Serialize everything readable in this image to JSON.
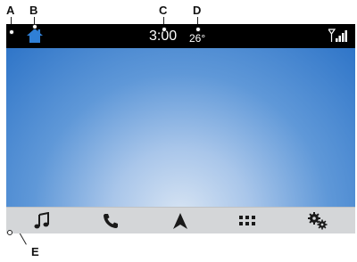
{
  "callouts": {
    "a": "A",
    "b": "B",
    "c": "C",
    "d": "D",
    "e": "E"
  },
  "status_bar": {
    "time": "3:00",
    "temperature": "26°",
    "home_icon": "home-icon",
    "signal_icon": "signal-strength-icon"
  },
  "dock": {
    "items": [
      {
        "icon": "music-note-icon"
      },
      {
        "icon": "phone-icon"
      },
      {
        "icon": "navigation-arrow-icon"
      },
      {
        "icon": "apps-grid-icon"
      },
      {
        "icon": "settings-gears-icon"
      }
    ]
  },
  "colors": {
    "home_accent": "#2f7fd6",
    "status_bar_bg": "#000000",
    "dock_bg": "#d4d6d8",
    "icon_color": "#1a1a1a"
  }
}
